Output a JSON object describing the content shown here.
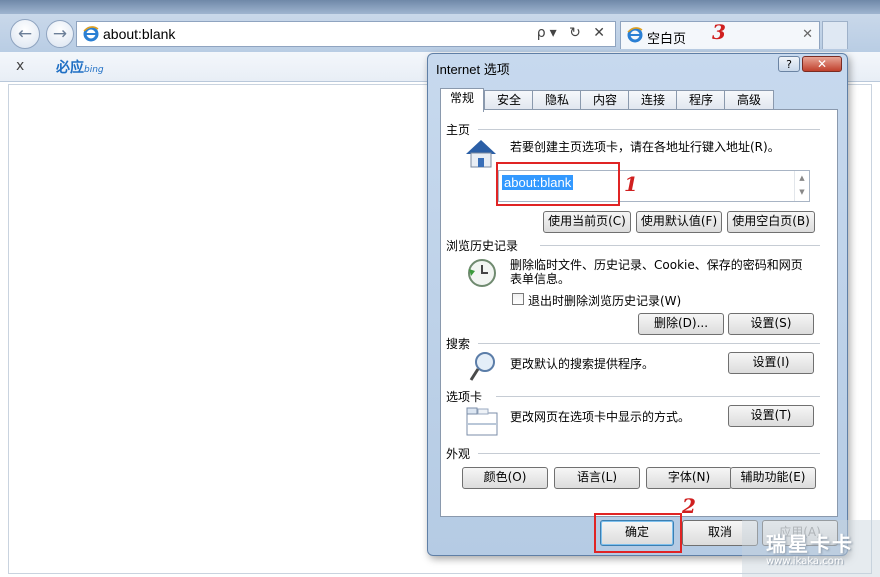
{
  "browser": {
    "address": "about:blank",
    "address_tools": "ρ▾ ↻ ✕",
    "tab_title": "空白页",
    "tab_close": "✕",
    "fav_close": "x",
    "bing_label": "必应",
    "bing_sub": "bing"
  },
  "annotations": {
    "one": "1",
    "two": "2",
    "three": "3"
  },
  "dialog": {
    "title": "Internet 选项",
    "help": "?",
    "close": "✕",
    "tabs": [
      "常规",
      "安全",
      "隐私",
      "内容",
      "连接",
      "程序",
      "高级"
    ],
    "homepage": {
      "label": "主页",
      "desc": "若要创建主页选项卡，请在各地址行键入地址(R)。",
      "value": "about:blank",
      "btn_current": "使用当前页(C)",
      "btn_default": "使用默认值(F)",
      "btn_blank": "使用空白页(B)"
    },
    "history": {
      "label": "浏览历史记录",
      "desc1": "删除临时文件、历史记录、Cookie、保存的密码和网页",
      "desc2": "表单信息。",
      "checkbox": "退出时删除浏览历史记录(W)",
      "checked": false,
      "btn_delete": "删除(D)...",
      "btn_settings": "设置(S)"
    },
    "search": {
      "label": "搜索",
      "desc": "更改默认的搜索提供程序。",
      "btn_settings": "设置(I)"
    },
    "tabs_section": {
      "label": "选项卡",
      "desc": "更改网页在选项卡中显示的方式。",
      "btn_settings": "设置(T)"
    },
    "appearance": {
      "label": "外观",
      "btn_colors": "颜色(O)",
      "btn_languages": "语言(L)",
      "btn_fonts": "字体(N)",
      "btn_accessibility": "辅助功能(E)"
    },
    "footer": {
      "ok": "确定",
      "cancel": "取消",
      "apply": "应用(A)"
    }
  },
  "watermark": {
    "big": "瑞星卡卡",
    "small": "www.ikaka.com"
  }
}
